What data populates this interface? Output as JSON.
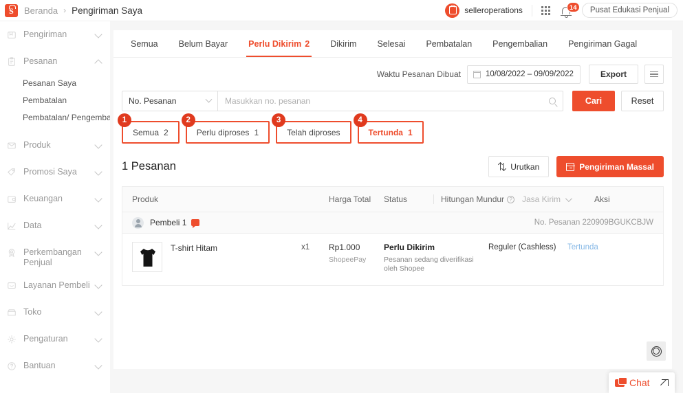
{
  "topbar": {
    "logo": "shopee-logo",
    "breadcrumb_home": "Beranda",
    "breadcrumb_sep": "›",
    "breadcrumb_current": "Pengiriman Saya",
    "account_name": "selleroperations",
    "apps_icon": "apps-grid-icon",
    "bell_icon": "notification-bell-icon",
    "notification_count": "14",
    "edu_button": "Pusat Edukasi Penjual"
  },
  "sidebar": {
    "items": [
      {
        "label": "Pengiriman",
        "icon": "shipping-icon",
        "expanded": false
      },
      {
        "label": "Pesanan",
        "icon": "order-list-icon",
        "expanded": true,
        "children": [
          "Pesanan Saya",
          "Pembatalan",
          "Pembatalan/ Pengembalian"
        ]
      },
      {
        "label": "Produk",
        "icon": "product-box-icon",
        "expanded": false
      },
      {
        "label": "Promosi Saya",
        "icon": "tag-icon",
        "expanded": false
      },
      {
        "label": "Keuangan",
        "icon": "wallet-icon",
        "expanded": false
      },
      {
        "label": "Data",
        "icon": "chart-line-icon",
        "expanded": false
      },
      {
        "label": "Perkembangan Penjual",
        "icon": "medal-icon",
        "expanded": false
      },
      {
        "label": "Layanan Pembeli",
        "icon": "chat-support-icon",
        "expanded": false
      },
      {
        "label": "Toko",
        "icon": "storefront-icon",
        "expanded": false
      },
      {
        "label": "Pengaturan",
        "icon": "gear-icon",
        "expanded": false
      },
      {
        "label": "Bantuan",
        "icon": "help-circle-icon",
        "expanded": false
      }
    ]
  },
  "tabs": [
    {
      "label": "Semua",
      "count": "",
      "active": false
    },
    {
      "label": "Belum Bayar",
      "count": "",
      "active": false
    },
    {
      "label": "Perlu Dikirim",
      "count": "2",
      "active": true
    },
    {
      "label": "Dikirim",
      "count": "",
      "active": false
    },
    {
      "label": "Selesai",
      "count": "",
      "active": false
    },
    {
      "label": "Pembatalan",
      "count": "",
      "active": false
    },
    {
      "label": "Pengembalian",
      "count": "",
      "active": false
    },
    {
      "label": "Pengiriman Gagal",
      "count": "",
      "active": false
    }
  ],
  "filters": {
    "date_label": "Waktu Pesanan Dibuat",
    "date_value": "10/08/2022 – 09/09/2022",
    "calendar_icon": "calendar-icon",
    "export_label": "Export",
    "more_icon": "list-menu-icon",
    "select_value": "No. Pesanan",
    "search_placeholder": "Masukkan no. pesanan",
    "search_value": "",
    "search_icon": "search-icon",
    "search_button": "Cari",
    "reset_button": "Reset"
  },
  "chips": [
    {
      "anno": "1",
      "label": "Semua",
      "count": "2",
      "active": false
    },
    {
      "anno": "2",
      "label": "Perlu diproses",
      "count": "1",
      "active": false
    },
    {
      "anno": "3",
      "label": "Telah diproses",
      "count": "",
      "active": false
    },
    {
      "anno": "4",
      "label": "Tertunda",
      "count": "1",
      "active": true
    }
  ],
  "list": {
    "count_title": "1 Pesanan",
    "sort_button": "Urutkan",
    "sort_icon": "sort-arrows-icon",
    "mass_button": "Pengiriman Massal",
    "mass_icon": "mass-ship-icon"
  },
  "table": {
    "headers": {
      "produk": "Produk",
      "harga_total": "Harga Total",
      "status": "Status",
      "hitungan_mundur": "Hitungan Mundur",
      "help_icon": "question-mark-icon",
      "jasa_kirim": "Jasa Kirim",
      "jasa_chevron": "chevron-down-icon",
      "aksi": "Aksi"
    },
    "orders": [
      {
        "buyer_avatar": "buyer-avatar-icon",
        "buyer_name": "Pembeli 1",
        "chat_icon": "chat-bubble-icon",
        "order_no_label": "No. Pesanan",
        "order_no": "220909BGUKCBJW",
        "product_name": "T-shirt Hitam",
        "product_thumb": "black-tshirt-thumbnail",
        "quantity": "x1",
        "price": "Rp1.000",
        "payment": "ShopeePay",
        "status": "Perlu Dikirim",
        "status_note": "Pesanan sedang diverifikasi oleh Shopee",
        "shipping": "Reguler (Cashless)",
        "action": "Tertunda"
      }
    ]
  },
  "floating": {
    "scroll_icon": "loading-ring-icon",
    "chat_icon": "chat-icon",
    "chat_label": "Chat",
    "expand_icon": "expand-arrow-icon"
  },
  "colors": {
    "brand": "#ee4d2d",
    "annotation": "#e03a1e",
    "page_bg": "#f6f6f6",
    "link": "#86b8e6"
  }
}
